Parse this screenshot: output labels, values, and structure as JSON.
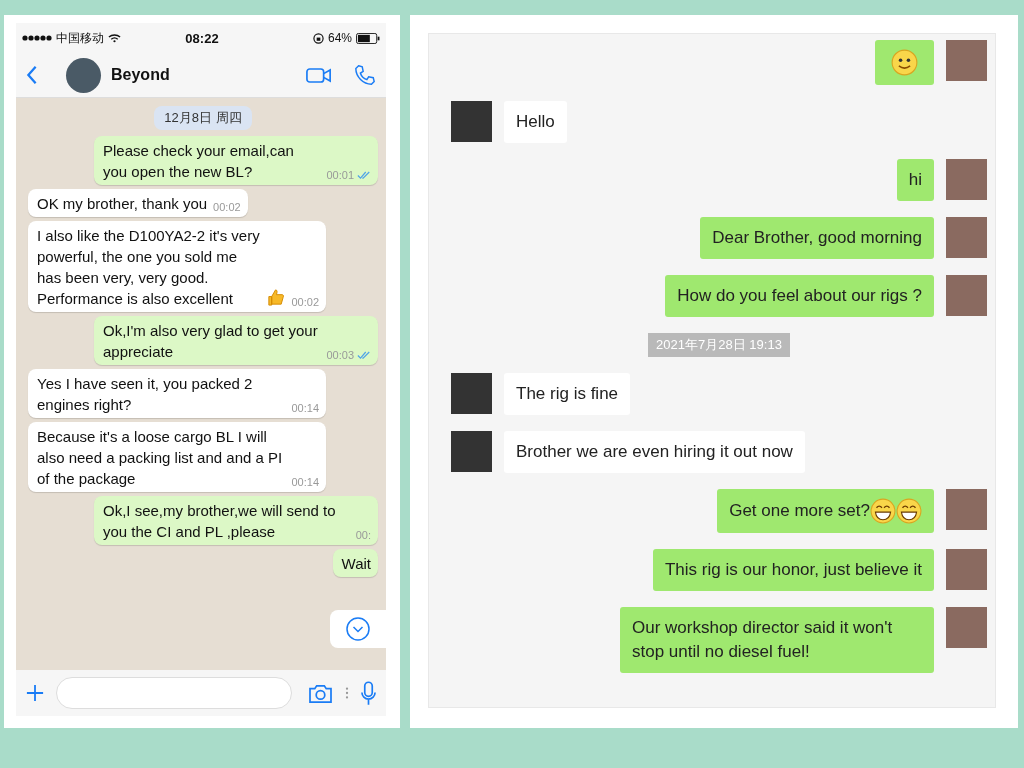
{
  "phone": {
    "status_bar": {
      "carrier": "中国移动",
      "time": "08:22",
      "battery": "64%"
    },
    "header": {
      "contact": "Beyond"
    },
    "date_chip": "12月8日 周四",
    "messages": [
      {
        "outgoing": true,
        "text": "Please check your email,can you open the new BL?",
        "time": "00:01",
        "read": true
      },
      {
        "outgoing": false,
        "text": "OK my brother, thank you",
        "time": "00:02"
      },
      {
        "outgoing": false,
        "text": "I also like the D100YA2-2 it's very powerful, the one you sold me has been very, very good. Performance is also excellent",
        "emojis": [
          {
            "kind": "thumbs_up"
          }
        ],
        "time": "00:02"
      },
      {
        "outgoing": true,
        "text": "Ok,I'm also very glad to get your appreciate",
        "time": "00:03",
        "read": true
      },
      {
        "outgoing": false,
        "text": "Yes I have seen it, you packed 2 engines right?",
        "time": "00:14"
      },
      {
        "outgoing": false,
        "text": "Because it's a loose cargo BL I will also need a packing list and and a PI of the package",
        "time": "00:14"
      },
      {
        "outgoing": true,
        "text": "Ok,I see,my brother,we will send to you the CI and PL ,please",
        "time": "00:"
      },
      {
        "outgoing": true,
        "text": "Wait"
      }
    ]
  },
  "desktop_chat": {
    "messages": [
      {
        "kind": "message",
        "outgoing": true,
        "emojis": [
          {
            "kind": "smile"
          }
        ]
      },
      {
        "kind": "message",
        "outgoing": false,
        "text": "Hello"
      },
      {
        "kind": "message",
        "outgoing": true,
        "text": "hi"
      },
      {
        "kind": "message",
        "outgoing": true,
        "text": "Dear Brother, good morning"
      },
      {
        "kind": "message",
        "outgoing": true,
        "text": "How do you feel about our rigs ?"
      },
      {
        "kind": "timestamp",
        "text": "2021年7月28日 19:13"
      },
      {
        "kind": "message",
        "outgoing": false,
        "text": "The rig is fine"
      },
      {
        "kind": "message",
        "outgoing": false,
        "text": "Brother we are even hiring it out now"
      },
      {
        "kind": "message",
        "outgoing": true,
        "text": "Get one more set?",
        "emojis": [
          {
            "kind": "grin"
          },
          {
            "kind": "grin"
          }
        ]
      },
      {
        "kind": "message",
        "outgoing": true,
        "text": "This rig is our honor, just believe it"
      },
      {
        "kind": "message",
        "outgoing": true,
        "text": "Our workshop director said it won't stop until no diesel fuel!"
      }
    ]
  }
}
